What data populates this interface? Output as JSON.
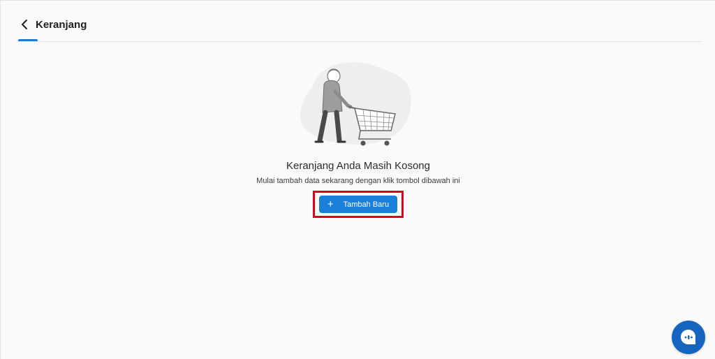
{
  "header": {
    "title": "Keranjang",
    "back_icon": "chevron-left-icon"
  },
  "empty_state": {
    "illustration": "shopping-cart-person-illustration",
    "title": "Keranjang Anda Masih Kosong",
    "subtitle": "Mulai tambah data sekarang dengan klik tombol dibawah ini",
    "button_label": "Tambah Baru",
    "button_icon": "plus-icon"
  },
  "chat": {
    "icon": "chat-bubble-icon"
  },
  "colors": {
    "accent": "#1a7fd9",
    "highlight": "#e0001b",
    "chat_fab": "#1565c0"
  }
}
